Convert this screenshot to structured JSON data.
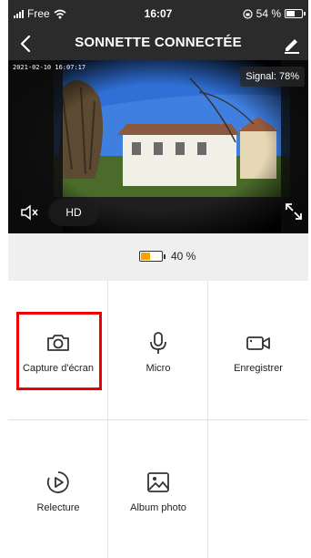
{
  "status_bar": {
    "carrier": "Free",
    "time": "16:07",
    "battery_percent": "54 %"
  },
  "nav": {
    "title": "SONNETTE CONNECTÉE"
  },
  "video": {
    "timestamp": "2021-02-10 16:07:17",
    "signal": "Signal: 78%",
    "quality": "HD"
  },
  "battery": {
    "level_text": "40 %",
    "level_fraction": 0.4,
    "color": "#f6a400"
  },
  "actions": [
    {
      "label": "Capture d'écran",
      "icon": "camera-icon"
    },
    {
      "label": "Micro",
      "icon": "microphone-icon"
    },
    {
      "label": "Enregistrer",
      "icon": "video-camera-icon"
    },
    {
      "label": "Relecture",
      "icon": "playback-icon"
    },
    {
      "label": "Album photo",
      "icon": "photo-album-icon"
    }
  ],
  "colors": {
    "header_bg": "#2b2b2b",
    "highlight": "#e00000"
  }
}
